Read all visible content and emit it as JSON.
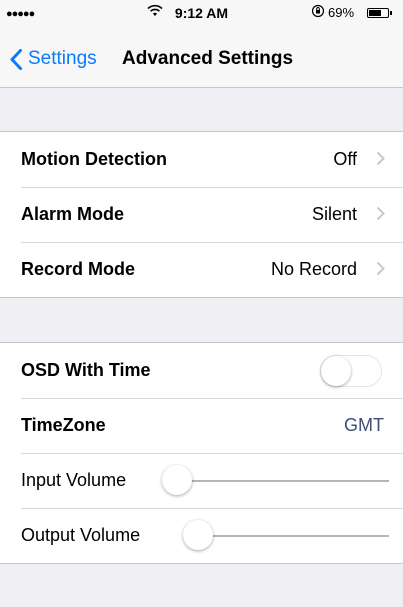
{
  "status_bar": {
    "signal": "●●●●●",
    "time": "9:12 AM",
    "battery_text": "69%",
    "battery_level": 0.69,
    "icons": [
      "wifi-icon",
      "orientation-lock-icon",
      "battery-icon"
    ]
  },
  "nav": {
    "back_label": "Settings",
    "title": "Advanced Settings",
    "accent_color": "#0a7aff"
  },
  "group1": [
    {
      "label": "Motion Detection",
      "value": "Off"
    },
    {
      "label": "Alarm Mode",
      "value": "Silent"
    },
    {
      "label": "Record Mode",
      "value": "No Record"
    }
  ],
  "group2": {
    "osd": {
      "label": "OSD With Time",
      "on": false
    },
    "timezone": {
      "label": "TimeZone",
      "value": "GMT"
    },
    "input_volume": {
      "label": "Input Volume",
      "level": 0
    },
    "output_volume": {
      "label": "Output Volume",
      "level": 0
    }
  }
}
